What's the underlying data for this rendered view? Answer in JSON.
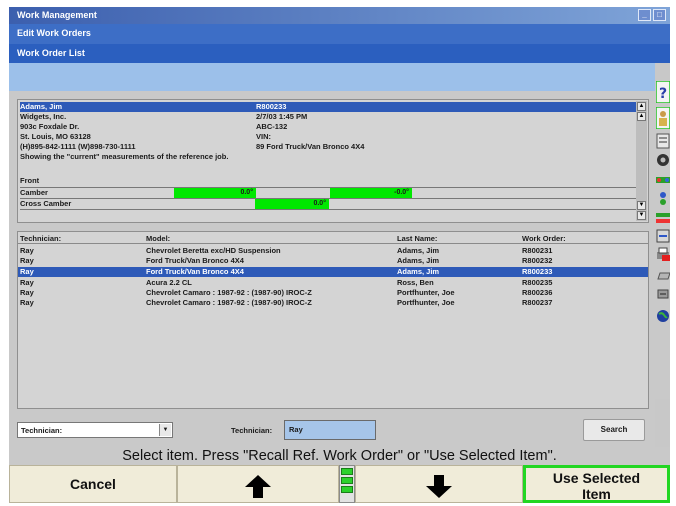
{
  "window": {
    "title": "Work Management",
    "bar2": "Edit Work Orders",
    "bar3": "Work Order List"
  },
  "details": {
    "rows": [
      {
        "a": "Adams, Jim",
        "b": "R800233"
      },
      {
        "a": "Widgets, Inc.",
        "b": "2/7/03 1:45 PM"
      },
      {
        "a": "903c Foxdale Dr.",
        "b": "ABC-132"
      },
      {
        "a": "St. Louis, MO  63128",
        "b": "VIN:"
      },
      {
        "a": "(H)895-842-1111 (W)898-730-1111",
        "b": "89 Ford Truck/Van Bronco 4X4"
      },
      {
        "a": "Showing the \"current\" measurements of the reference job.",
        "b": ""
      }
    ],
    "section": "Front",
    "meas": [
      {
        "label": "Camber",
        "left": "0.0°",
        "right": "-0.0°"
      },
      {
        "label": "Cross Camber",
        "center": "0.0°"
      }
    ]
  },
  "list": {
    "headers": [
      "Technician:",
      "Model:",
      "Last Name:",
      "Work Order:"
    ],
    "rows": [
      [
        "Ray",
        "Chevrolet Beretta exc/HD Suspension",
        "Adams, Jim",
        "R800231"
      ],
      [
        "Ray",
        "Ford Truck/Van Bronco 4X4",
        "Adams, Jim",
        "R800232"
      ],
      [
        "Ray",
        "Ford Truck/Van Bronco 4X4",
        "Adams, Jim",
        "R800233"
      ],
      [
        "Ray",
        "Acura 2.2 CL",
        "Ross, Ben",
        "R800235"
      ],
      [
        "Ray",
        "Chevrolet Camaro : 1987-92 : (1987-90) IROC-Z",
        "Portfhunter, Joe",
        "R800236"
      ],
      [
        "Ray",
        "Chevrolet Camaro : 1987-92 : (1987-90) IROC-Z",
        "Portfhunter, Joe",
        "R800237"
      ]
    ],
    "selected_index": 2
  },
  "filter": {
    "select_value": "Technician:",
    "tech_label": "Technician:",
    "tech_value": "Ray",
    "search_label": "Search"
  },
  "prompt": "Select item.  Press \"Recall Ref. Work Order\" or \"Use Selected Item\".",
  "buttons": {
    "cancel": "Cancel",
    "use_selected_line1": "Use Selected",
    "use_selected_line2": "Item"
  },
  "colors": {
    "selection": "#2e5ab8",
    "measurement": "#00e800",
    "button_bg": "#f0ecd9",
    "active_border": "#22d622"
  }
}
